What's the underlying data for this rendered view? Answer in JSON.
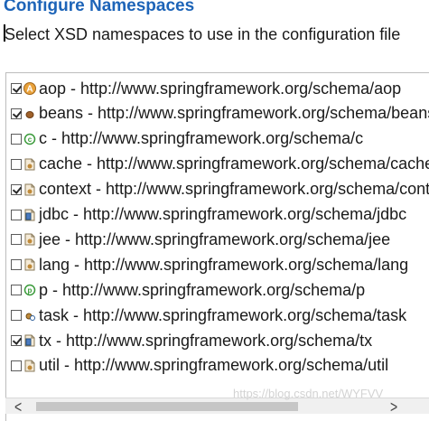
{
  "page": {
    "title": "Configure Namespaces",
    "description": "Select XSD namespaces to use in the configuration file",
    "watermark": "https://blog.csdn.net/WYFVV"
  },
  "colors": {
    "title": "#1d64b8",
    "scrollbar_track": "#f0f0f0",
    "scrollbar_thumb": "#c6c6c6"
  },
  "namespaces": [
    {
      "label": "aop - http://www.springframework.org/schema/aop",
      "checked": true,
      "icon": "aop-icon"
    },
    {
      "label": "beans - http://www.springframework.org/schema/beans",
      "checked": true,
      "icon": "bean-icon"
    },
    {
      "label": "c - http://www.springframework.org/schema/c",
      "checked": false,
      "icon": "c-namespace-icon"
    },
    {
      "label": "cache - http://www.springframework.org/schema/cache",
      "checked": false,
      "icon": "cache-icon"
    },
    {
      "label": "context - http://www.springframework.org/schema/context",
      "checked": true,
      "icon": "context-icon"
    },
    {
      "label": "jdbc - http://www.springframework.org/schema/jdbc",
      "checked": false,
      "icon": "jdbc-icon"
    },
    {
      "label": "jee - http://www.springframework.org/schema/jee",
      "checked": false,
      "icon": "jee-icon"
    },
    {
      "label": "lang - http://www.springframework.org/schema/lang",
      "checked": false,
      "icon": "lang-icon"
    },
    {
      "label": "p - http://www.springframework.org/schema/p",
      "checked": false,
      "icon": "p-namespace-icon"
    },
    {
      "label": "task - http://www.springframework.org/schema/task",
      "checked": false,
      "icon": "task-icon"
    },
    {
      "label": "tx - http://www.springframework.org/schema/tx",
      "checked": true,
      "icon": "tx-icon"
    },
    {
      "label": "util - http://www.springframework.org/schema/util",
      "checked": false,
      "icon": "util-icon"
    }
  ],
  "scrollbar": {
    "left_arrow": "<",
    "right_arrow": ">"
  }
}
